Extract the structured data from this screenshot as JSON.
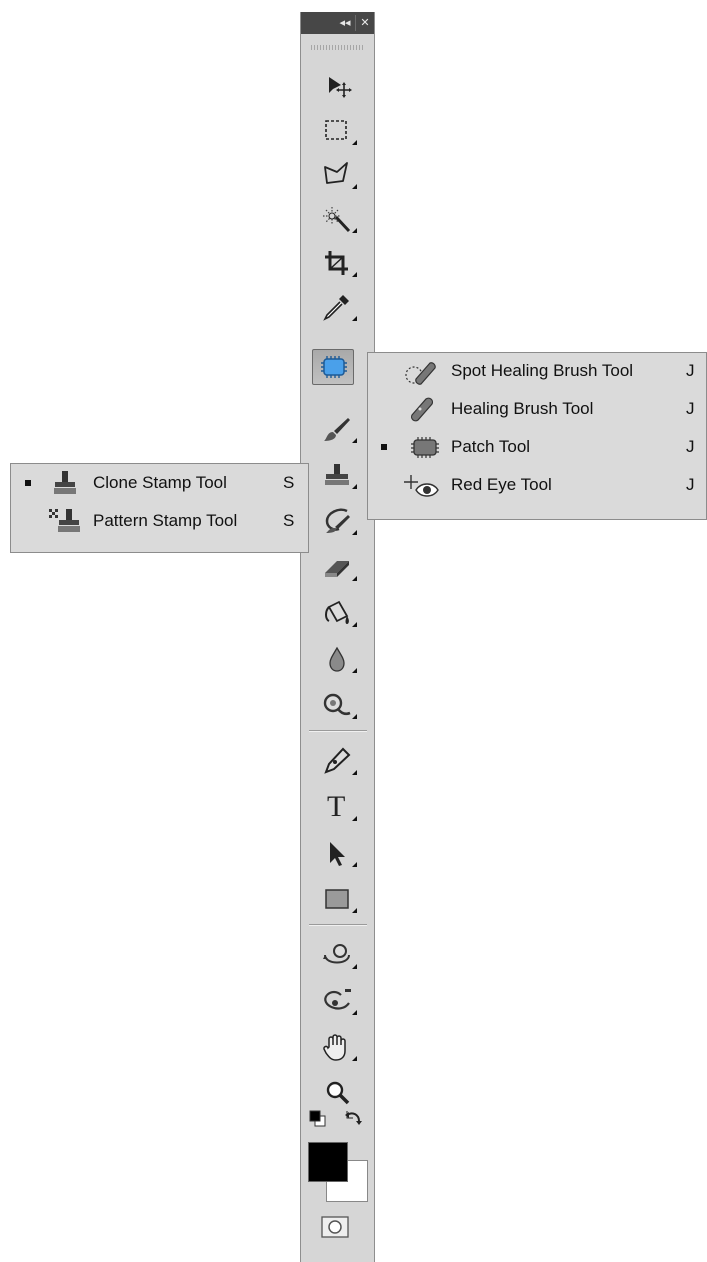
{
  "window": {
    "collapse_glyph": "◂◂",
    "close_glyph": "✕"
  },
  "toolbar": {
    "tools": [
      {
        "id": "move",
        "icon": "move-tool-icon",
        "has_submenu": false
      },
      {
        "id": "marquee",
        "icon": "rectangular-marquee-icon",
        "has_submenu": true
      },
      {
        "id": "lasso",
        "icon": "polygonal-lasso-icon",
        "has_submenu": true
      },
      {
        "id": "magic-wand",
        "icon": "magic-wand-icon",
        "has_submenu": true
      },
      {
        "id": "crop",
        "icon": "crop-icon",
        "has_submenu": true
      },
      {
        "id": "eyedropper",
        "icon": "eyedropper-icon",
        "has_submenu": true
      },
      {
        "id": "patch",
        "icon": "patch-icon",
        "has_submenu": true,
        "active": true
      },
      {
        "id": "brush",
        "icon": "brush-icon",
        "has_submenu": true
      },
      {
        "id": "clone-stamp",
        "icon": "clone-stamp-icon",
        "has_submenu": true
      },
      {
        "id": "history-brush",
        "icon": "history-brush-icon",
        "has_submenu": true
      },
      {
        "id": "eraser",
        "icon": "eraser-icon",
        "has_submenu": true
      },
      {
        "id": "paint-bucket",
        "icon": "paint-bucket-icon",
        "has_submenu": true
      },
      {
        "id": "blur",
        "icon": "blur-drop-icon",
        "has_submenu": true
      },
      {
        "id": "dodge",
        "icon": "dodge-icon",
        "has_submenu": true
      },
      {
        "id": "pen",
        "icon": "pen-icon",
        "has_submenu": true
      },
      {
        "id": "type",
        "icon": "type-icon",
        "has_submenu": true,
        "glyph": "T"
      },
      {
        "id": "path-selection",
        "icon": "path-selection-arrow-icon",
        "has_submenu": true
      },
      {
        "id": "rectangle",
        "icon": "rectangle-shape-icon",
        "has_submenu": true
      },
      {
        "id": "3d-rotate",
        "icon": "3d-rotate-icon",
        "has_submenu": true
      },
      {
        "id": "3d-orbit",
        "icon": "3d-orbit-icon",
        "has_submenu": true
      },
      {
        "id": "hand",
        "icon": "hand-icon",
        "has_submenu": true
      },
      {
        "id": "zoom",
        "icon": "zoom-icon",
        "has_submenu": false
      }
    ]
  },
  "healing_flyout": {
    "items": [
      {
        "label": "Spot Healing Brush Tool",
        "shortcut": "J",
        "selected": false,
        "icon": "spot-healing-brush-icon"
      },
      {
        "label": "Healing Brush Tool",
        "shortcut": "J",
        "selected": false,
        "icon": "healing-brush-icon"
      },
      {
        "label": "Patch Tool",
        "shortcut": "J",
        "selected": true,
        "icon": "patch-icon"
      },
      {
        "label": "Red Eye Tool",
        "shortcut": "J",
        "selected": false,
        "icon": "red-eye-icon"
      }
    ]
  },
  "stamp_flyout": {
    "items": [
      {
        "label": "Clone Stamp Tool",
        "shortcut": "S",
        "selected": true,
        "icon": "clone-stamp-icon"
      },
      {
        "label": "Pattern Stamp Tool",
        "shortcut": "S",
        "selected": false,
        "icon": "pattern-stamp-icon"
      }
    ]
  },
  "colors": {
    "foreground": "#000000",
    "background": "#ffffff",
    "toolbar_bg": "#d6d6d6",
    "titlebar_bg": "#474747",
    "active_tool_bg": "#b3b3b3"
  },
  "bottom": {
    "default_colors_icon": "default-colors-icon",
    "swap_colors_icon": "swap-colors-icon",
    "quick_mask_icon": "quick-mask-icon"
  }
}
